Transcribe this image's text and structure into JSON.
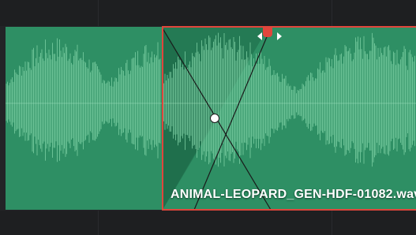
{
  "timeline": {
    "clips": [
      {
        "id": "clip-left",
        "selected": false
      },
      {
        "id": "clip-right",
        "selected": true,
        "name": "ANIMAL-LEOPARD_GEN-HDF-01082.wav"
      }
    ]
  },
  "colors": {
    "background": "#1e1f21",
    "clip_fill": "#2e8f64",
    "clip_fill_dark": "#1d6a47",
    "waveform": "#7fd2a6",
    "selection_outline": "#e0463c",
    "fade_handle": "#e0463c"
  },
  "icons": {
    "fade_handle": "fade-handle-icon",
    "arrow_left": "chevron-left-icon",
    "arrow_right": "chevron-right-icon",
    "crossfade_node": "crossfade-node-icon"
  }
}
